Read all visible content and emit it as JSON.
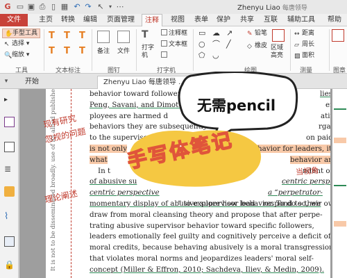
{
  "titlebar": {
    "user_name": "Zhenyu Liao",
    "user_extra": "每唐领导"
  },
  "menubar": {
    "items": [
      "文件",
      "主页",
      "转换",
      "编辑",
      "页面管理",
      "注释",
      "视图",
      "表单",
      "保护",
      "共享",
      "互联",
      "辅助工具",
      "帮助"
    ]
  },
  "ribbon": {
    "tools": {
      "hand_tool": "手型工具",
      "select": "选择",
      "zoom": "缩放",
      "label": "工具"
    },
    "text_markup": {
      "label": "文本标注"
    },
    "pin": {
      "note": "备注",
      "file": "文件",
      "label": "图钉"
    },
    "typewriter": {
      "typewriter": "打字机",
      "callout": "注释框",
      "textbox": "文本框",
      "label": "打字机"
    },
    "drawing": {
      "pencil": "铅笔",
      "eraser": "橡皮",
      "area_highlight": "区域高亮",
      "label": "绘图"
    },
    "measure": {
      "distance": "距离",
      "perimeter": "周长",
      "area": "面积",
      "label": "测量"
    },
    "stamp": {
      "label": "图章"
    }
  },
  "tabs": {
    "start": "开始",
    "doc": "Zhenyu Liao 每唐领导 ..."
  },
  "document": {
    "lines": [
      "behavior toward followers",
      "Peng, Savani, and Dimott",
      "ployees are harmed d",
      "behaviors they are subsequently",
      "to the supervisor. Because of the",
      "is not only ",
      "what",
      "In t",
      "of abusive su",
      "centric perspective",
      "momentary display of abusive supervisor behavior. To do so, we",
      "draw from moral cleansing theory and propose that after perpe-",
      "trating abusive supervisor behavior toward specific followers,",
      "leaders emotionally feel guilty and cognitively perceive a deficit of",
      "moral credits, because behaving abusively is a moral transgression",
      "that violates moral norms and jeopardizes leaders' moral self-",
      "concept (Miller & Effron, 2010; Sachdeva, Iliev, & Medin, 2009)."
    ],
    "right_fragments": {
      "l1": "lies,",
      "l2": "em-",
      "l3": "ative",
      "l4": "rgani-",
      "l5": "on paid",
      "l6": "havior for leaders, it",
      "l7": "behavior and",
      "l8": "ndent of",
      "l9": "centric perspec-",
      "l10": "a “perpetrator-",
      "l11": "” to explore how lead",
      "l12": "respond to their own"
    },
    "margin_notes": {
      "note1_a": "现有研究",
      "note1_b": "忽视的问题",
      "note2": "理论阐述",
      "note3": "当视角"
    },
    "side_text": "It is not to be disseminated broadly. use of its allied publishers."
  },
  "overlays": {
    "bubble_text": "无需pencil",
    "yellow_text": "手写体笔记"
  },
  "colors": {
    "accent": "#c8423a",
    "highlight": "#f8c9a8",
    "underline": "#2e8b57",
    "yellow": "#f5c842"
  }
}
